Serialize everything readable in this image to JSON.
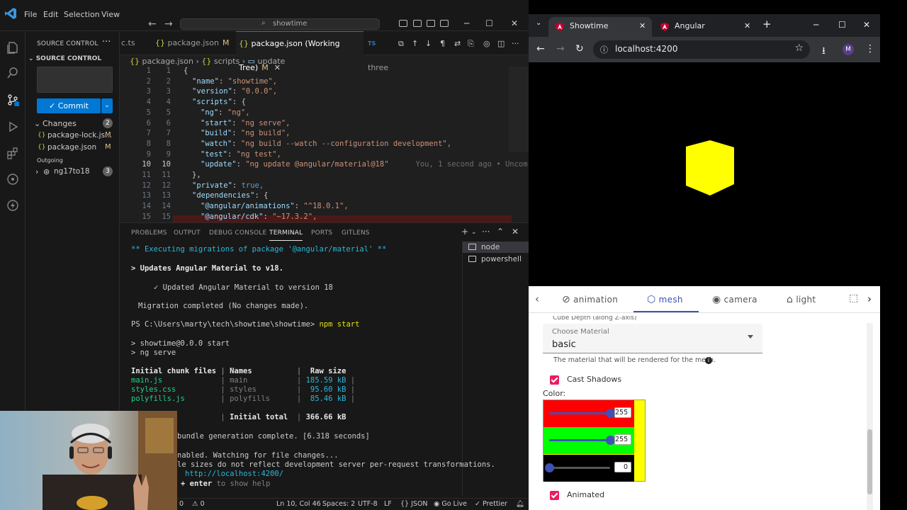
{
  "vscode": {
    "menu": [
      "File",
      "Edit",
      "Selection",
      "View"
    ],
    "search": "showtime",
    "sidebar": {
      "title": "SOURCE CONTROL",
      "section": "SOURCE CONTROL",
      "commit_label": "Commit",
      "changes_label": "Changes",
      "changes_count": "2",
      "files": [
        {
          "name": "package-lock.js...",
          "status": "M"
        },
        {
          "name": "package.json",
          "status": "M"
        }
      ],
      "outgoing_label": "Outgoing",
      "branch": "ng17to18",
      "branch_count": "3"
    },
    "tabs": [
      {
        "label": "c.ts"
      },
      {
        "label": "package.json",
        "flag": "M"
      },
      {
        "label": "package.json (Working Tree)",
        "flag": "M"
      },
      {
        "label": "three"
      }
    ],
    "breadcrumb": [
      "package.json",
      "scripts",
      "update"
    ],
    "code": [
      {
        "ln": "1",
        "ln2": "1",
        "text": "{"
      },
      {
        "ln": "2",
        "ln2": "2",
        "key": "\"name\"",
        "val": "\"showtime\","
      },
      {
        "ln": "3",
        "ln2": "3",
        "key": "\"version\"",
        "val": "\"0.0.0\","
      },
      {
        "ln": "4",
        "ln2": "4",
        "key": "\"scripts\"",
        "val": "{"
      },
      {
        "ln": "5",
        "ln2": "5",
        "key": "\"ng\"",
        "val": "\"ng\","
      },
      {
        "ln": "6",
        "ln2": "6",
        "key": "\"start\"",
        "val": "\"ng serve\","
      },
      {
        "ln": "7",
        "ln2": "7",
        "key": "\"build\"",
        "val": "\"ng build\","
      },
      {
        "ln": "8",
        "ln2": "8",
        "key": "\"watch\"",
        "val": "\"ng build --watch --configuration development\","
      },
      {
        "ln": "9",
        "ln2": "9",
        "key": "\"test\"",
        "val": "\"ng test\","
      },
      {
        "ln": "10",
        "ln2": "10",
        "key": "\"update\"",
        "val": "\"ng update @angular/material@18\""
      },
      {
        "ln": "11",
        "ln2": "11",
        "text": "},"
      },
      {
        "ln": "12",
        "ln2": "12",
        "key": "\"private\"",
        "val": "true,"
      },
      {
        "ln": "13",
        "ln2": "13",
        "key": "\"dependencies\"",
        "val": "{"
      },
      {
        "ln": "14",
        "ln2": "14",
        "key": "\"@angular/animations\"",
        "val": "\"^18.0.1\","
      },
      {
        "ln": "15",
        "ln2": "15",
        "key": "\"@angular/cdk\"",
        "val": "\"~17.3.2\","
      }
    ],
    "blame": "You, 1 second ago • Uncom",
    "panel_tabs": [
      "PROBLEMS",
      "OUTPUT",
      "DEBUG CONSOLE",
      "TERMINAL",
      "PORTS",
      "GITLENS"
    ],
    "terminal": {
      "l1": "** Executing migrations of package '@angular/material' **",
      "l2": "> Updates Angular Material to v18.",
      "l3": "✓ Updated Angular Material to version 18",
      "l4": "Migration completed (No changes made).",
      "prompt": "PS C:\\Users\\marty\\tech\\showtime\\showtime>",
      "cmd": "npm start",
      "l5": "> showtime@0.0.0 start",
      "l6": "> ng serve",
      "hdr_files": "Initial chunk files",
      "hdr_names": "Names",
      "hdr_size": "Raw size",
      "rows": [
        {
          "file": "main.js",
          "name": "main",
          "size": "185.59 kB"
        },
        {
          "file": "styles.css",
          "name": "styles",
          "size": "95.60 kB"
        },
        {
          "file": "polyfills.js",
          "name": "polyfills",
          "size": "85.46 kB"
        }
      ],
      "total_label": "Initial total",
      "total": "366.66 kB",
      "l7": "bundle generation complete. [6.318 seconds]",
      "l8": "nabled. Watching for file changes...",
      "l9": "le sizes do not reflect development server per-request transformations.",
      "url": "http://localhost:4200/",
      "l10a": "+ enter",
      "l10b": "to show help"
    },
    "terminals": [
      "node",
      "powershell"
    ],
    "status": {
      "errors": "0",
      "warnings": "0",
      "position": "Ln 10, Col 46",
      "spaces": "Spaces: 2",
      "encoding": "UTF-8",
      "eol": "LF",
      "lang": "JSON",
      "golive": "Go Live",
      "prettier": "Prettier"
    }
  },
  "chrome": {
    "tabs": [
      "Showtime",
      "Angular"
    ],
    "url": "localhost:4200",
    "profile": "M",
    "mat_tabs": [
      "animation",
      "mesh",
      "camera",
      "light"
    ],
    "cut_label": "Cube Depth (along Z-axis)",
    "material_label": "Choose Material",
    "material_value": "basic",
    "material_hint": "The material that will be rendered for the mesh.",
    "cast_shadows": "Cast Shadows",
    "color_label": "Color:",
    "color": {
      "r": 255,
      "g": 255,
      "b": 0
    },
    "r_text": "255",
    "g_text": "255",
    "b_text": "0",
    "animated": "Animated",
    "colors": {
      "accent": "#3f51b5",
      "checkbox": "#e91e63",
      "cube": "#ffff00"
    }
  }
}
